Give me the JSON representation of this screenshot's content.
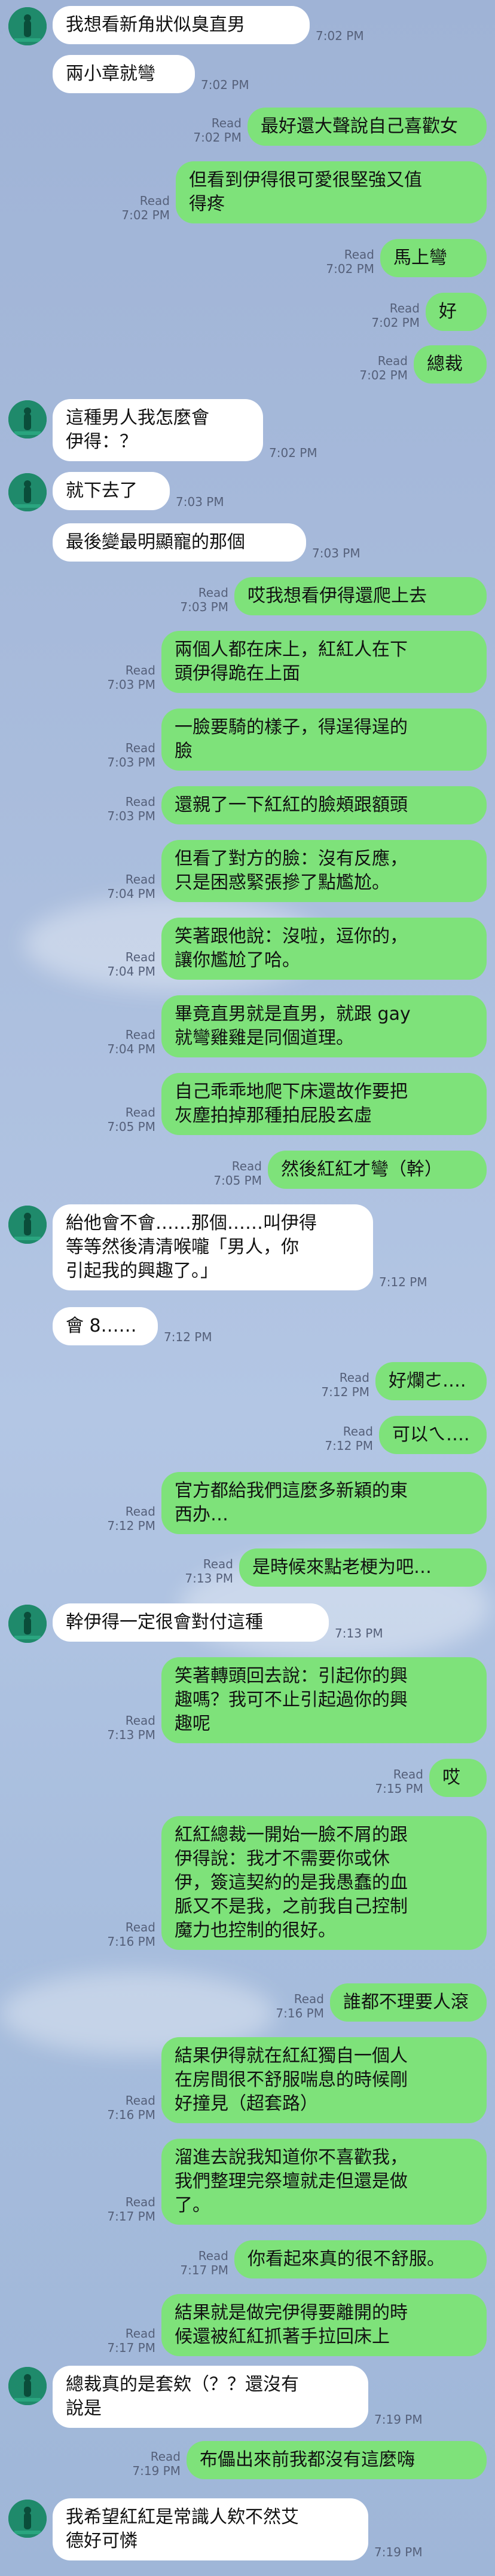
{
  "colors": {
    "incoming_bubble": "#ffffff",
    "outgoing_bubble": "#7ee27a",
    "background": "#a9bcdc"
  },
  "read_label": "Read",
  "messages": [
    {
      "dir": "in",
      "avatar": true,
      "lines": [
        "我想看新角狀似臭直男"
      ],
      "time": "7:02 PM"
    },
    {
      "dir": "in",
      "avatar": false,
      "lines": [
        "兩小章就彎"
      ],
      "time": "7:02 PM"
    },
    {
      "dir": "out",
      "lines": [
        "最好還大聲說自己喜歡女"
      ],
      "time": "7:02 PM"
    },
    {
      "dir": "out",
      "lines": [
        "但看到伊得很可愛很堅強又值",
        "得疼"
      ],
      "time": "7:02 PM"
    },
    {
      "dir": "out",
      "lines": [
        "馬上彎"
      ],
      "time": "7:02 PM"
    },
    {
      "dir": "out",
      "lines": [
        "好"
      ],
      "time": "7:02 PM"
    },
    {
      "dir": "out",
      "lines": [
        "總裁"
      ],
      "time": "7:02 PM"
    },
    {
      "dir": "in",
      "avatar": true,
      "lines": [
        "這種男人我怎麼會",
        "伊得：？"
      ],
      "time": "7:02 PM"
    },
    {
      "dir": "in",
      "avatar": true,
      "lines": [
        "就下去了"
      ],
      "time": "7:03 PM"
    },
    {
      "dir": "in",
      "avatar": false,
      "lines": [
        "最後變最明顯寵的那個"
      ],
      "time": "7:03 PM"
    },
    {
      "dir": "out",
      "lines": [
        "哎我想看伊得還爬上去"
      ],
      "time": "7:03 PM"
    },
    {
      "dir": "out",
      "lines": [
        "兩個人都在床上，紅紅人在下",
        "頭伊得跪在上面"
      ],
      "time": "7:03 PM"
    },
    {
      "dir": "out",
      "lines": [
        "一臉要騎的樣子，得逞得逞的",
        "臉"
      ],
      "time": "7:03 PM"
    },
    {
      "dir": "out",
      "lines": [
        "還親了一下紅紅的臉頰跟額頭"
      ],
      "time": "7:03 PM"
    },
    {
      "dir": "out",
      "lines": [
        "但看了對方的臉：沒有反應，",
        "只是困惑緊張摻了點尷尬。"
      ],
      "time": "7:04 PM"
    },
    {
      "dir": "out",
      "lines": [
        "笑著跟他說：沒啦，逗你的，",
        "讓你尷尬了哈。"
      ],
      "time": "7:04 PM"
    },
    {
      "dir": "out",
      "lines": [
        "畢竟直男就是直男，就跟 gay",
        "就彎雞雞是同個道理。"
      ],
      "time": "7:04 PM"
    },
    {
      "dir": "out",
      "lines": [
        "自己乖乖地爬下床還故作要把",
        "灰塵拍掉那種拍屁股玄虛"
      ],
      "time": "7:05 PM"
    },
    {
      "dir": "out",
      "lines": [
        "然後紅紅才彎（幹）"
      ],
      "time": "7:05 PM"
    },
    {
      "dir": "in",
      "avatar": true,
      "lines": [
        "紿他會不會……那個……叫伊得",
        "等等然後清清喉嚨「男人，你",
        "引起我的興趣了。」"
      ],
      "time": "7:12 PM"
    },
    {
      "dir": "in",
      "avatar": false,
      "lines": [
        "會 8……"
      ],
      "time": "7:12 PM"
    },
    {
      "dir": "out",
      "lines": [
        "好爛ㄜ…."
      ],
      "time": "7:12 PM"
    },
    {
      "dir": "out",
      "lines": [
        "可以ㄟ…."
      ],
      "time": "7:12 PM"
    },
    {
      "dir": "out",
      "lines": [
        "官方都給我們這麼多新穎的東",
        "西办…"
      ],
      "time": "7:12 PM"
    },
    {
      "dir": "out",
      "lines": [
        "是時候來點老梗为吧…"
      ],
      "time": "7:13 PM"
    },
    {
      "dir": "in",
      "avatar": true,
      "lines": [
        "幹伊得一定很會對付這種"
      ],
      "time": "7:13 PM"
    },
    {
      "dir": "out",
      "lines": [
        "笑著轉頭回去說：引起你的興",
        "趣嗎？我可不止引起過你的興",
        "趣呢"
      ],
      "time": "7:13 PM"
    },
    {
      "dir": "out",
      "lines": [
        "哎"
      ],
      "time": "7:15 PM"
    },
    {
      "dir": "out",
      "lines": [
        "紅紅總裁一開始一臉不屑的跟",
        "伊得說：我才不需要你或休",
        "伊，簽這契約的是我愚蠢的血",
        "脈又不是我，之前我自己控制",
        "魔力也控制的很好。"
      ],
      "time": "7:16 PM"
    },
    {
      "dir": "out",
      "lines": [
        "誰都不理要人滾"
      ],
      "time": "7:16 PM"
    },
    {
      "dir": "out",
      "lines": [
        "結果伊得就在紅紅獨自一個人",
        "在房間很不舒服喘息的時候剛",
        "好撞見（超套路）"
      ],
      "time": "7:16 PM"
    },
    {
      "dir": "out",
      "lines": [
        "溜進去說我知道你不喜歡我，",
        "我們整理完祭壇就走但還是做",
        "了。"
      ],
      "time": "7:17 PM"
    },
    {
      "dir": "out",
      "lines": [
        "你看起來真的很不舒服。"
      ],
      "time": "7:17 PM"
    },
    {
      "dir": "out",
      "lines": [
        "結果就是做完伊得要離開的時",
        "候還被紅紅抓著手拉回床上"
      ],
      "time": "7:17 PM"
    },
    {
      "dir": "in",
      "avatar": true,
      "lines": [
        "總裁真的是套欸（？？還沒有",
        "說是"
      ],
      "time": "7:19 PM"
    },
    {
      "dir": "out",
      "lines": [
        "布儡出來前我都沒有這麼嗨"
      ],
      "time": "7:19 PM"
    },
    {
      "dir": "in",
      "avatar": true,
      "lines": [
        "我希望紅紅是常識人欸不然艾",
        "德好可憐"
      ],
      "time": "7:19 PM"
    }
  ]
}
